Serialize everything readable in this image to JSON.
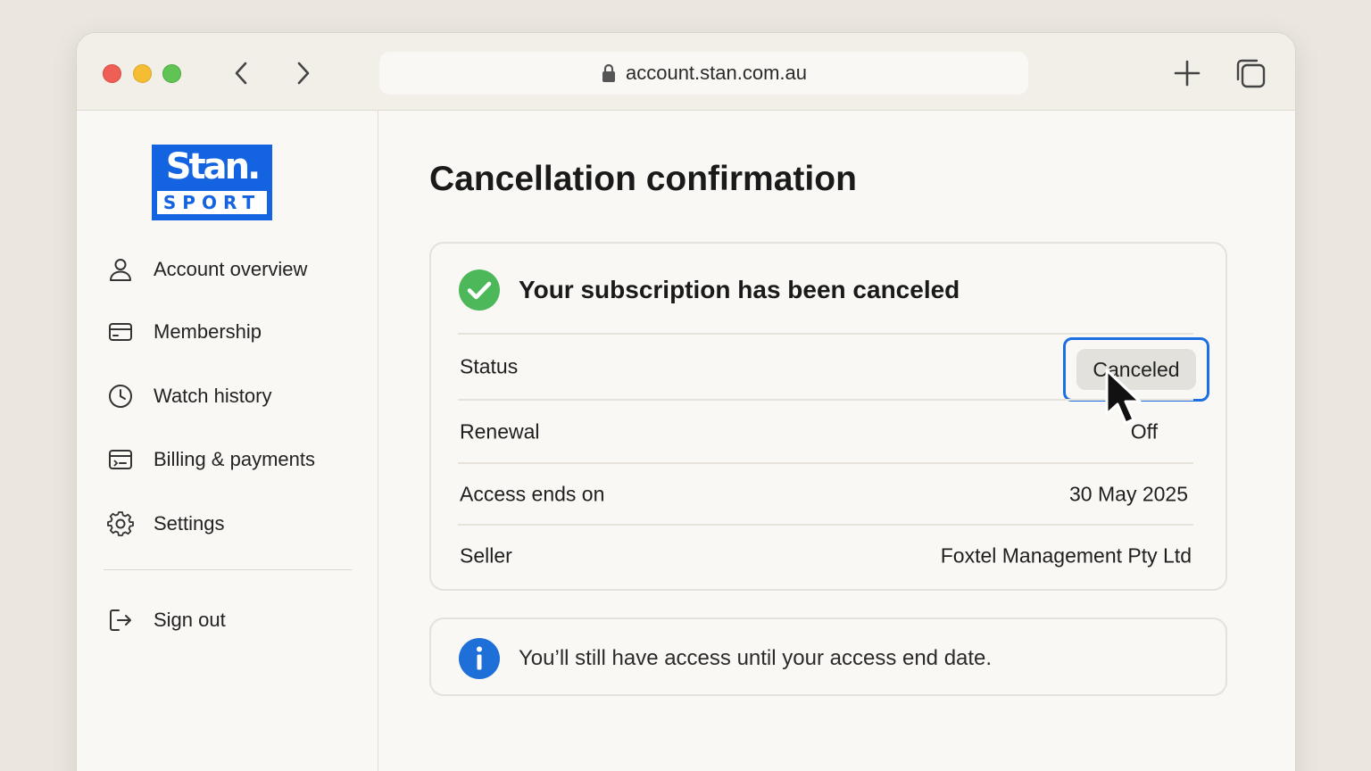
{
  "browser": {
    "url": "account.stan.com.au"
  },
  "sidebar": {
    "logo": {
      "top": "Stan.",
      "bottom": "SPORT",
      "brand_color": "#1463e0"
    },
    "items": [
      {
        "label": "Account overview",
        "icon": "person-icon"
      },
      {
        "label": "Membership",
        "icon": "card-icon"
      },
      {
        "label": "Watch history",
        "icon": "clock-icon"
      },
      {
        "label": "Billing & payments",
        "icon": "billing-icon"
      },
      {
        "label": "Settings",
        "icon": "gear-icon"
      }
    ],
    "sign_out": {
      "label": "Sign out",
      "icon": "sign-out-icon"
    }
  },
  "main": {
    "title": "Cancellation confirmation",
    "confirmation": {
      "heading": "Your subscription has been canceled",
      "icon": "check-circle-icon",
      "success_color": "#4cb85a",
      "rows": [
        {
          "label": "Status",
          "value": "Canceled"
        },
        {
          "label": "Renewal",
          "value": "Off"
        },
        {
          "label": "Access ends on",
          "value": "30 May 2025"
        },
        {
          "label": "Seller",
          "value": "Foxtel Management Pty Ltd"
        }
      ]
    },
    "info": {
      "icon": "info-icon",
      "text": "You’ll still have access until your access end date.",
      "info_color": "#1f6fd9"
    }
  }
}
